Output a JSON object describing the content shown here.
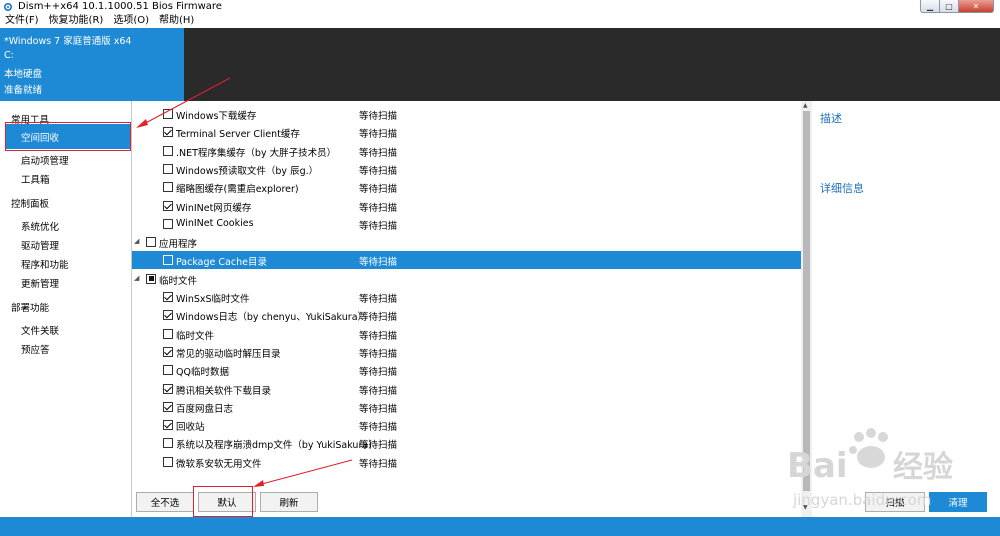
{
  "window": {
    "title": "Dism++x64 10.1.1000.51 Bios Firmware",
    "min_glyph": "▁",
    "max_glyph": "□",
    "close_glyph": "✕"
  },
  "menu": [
    {
      "label": "文件(F)"
    },
    {
      "label": "恢复功能(R)"
    },
    {
      "label": "选项(O)"
    },
    {
      "label": "帮助(H)"
    }
  ],
  "image_info": {
    "name": "*Windows 7 家庭普通版 x64",
    "drive": "C:",
    "disk": "本地硬盘",
    "status": "准备就绪"
  },
  "sidebar": {
    "groups": [
      {
        "label": "常用工具",
        "items": [
          {
            "label": "空间回收",
            "selected": true
          },
          {
            "label": "启动项管理"
          },
          {
            "label": "工具箱"
          }
        ]
      },
      {
        "label": "控制面板",
        "items": [
          {
            "label": "系统优化"
          },
          {
            "label": "驱动管理"
          },
          {
            "label": "程序和功能"
          },
          {
            "label": "更新管理"
          }
        ]
      },
      {
        "label": "部署功能",
        "items": [
          {
            "label": "文件关联"
          },
          {
            "label": "预应答"
          }
        ]
      }
    ]
  },
  "cleanup_list": [
    {
      "type": "item",
      "label": "Windows下载缓存",
      "state": "unchecked",
      "status": "等待扫描"
    },
    {
      "type": "item",
      "label": "Terminal Server Client缓存",
      "state": "checked",
      "status": "等待扫描"
    },
    {
      "type": "item",
      "label": ".NET程序集缓存（by 大胖子技术员）",
      "state": "unchecked",
      "status": "等待扫描"
    },
    {
      "type": "item",
      "label": "Windows预读取文件（by 辰g.）",
      "state": "unchecked",
      "status": "等待扫描"
    },
    {
      "type": "item",
      "label": "缩略图缓存(需重启explorer)",
      "state": "unchecked",
      "status": "等待扫描"
    },
    {
      "type": "item",
      "label": "WinINet网页缓存",
      "state": "checked",
      "status": "等待扫描"
    },
    {
      "type": "item",
      "label": "WinINet Cookies",
      "state": "unchecked",
      "status": "等待扫描"
    },
    {
      "type": "group",
      "label": "应用程序",
      "state": "unchecked"
    },
    {
      "type": "item",
      "label": "Package Cache目录",
      "state": "unchecked",
      "status": "等待扫描",
      "selected": true
    },
    {
      "type": "group",
      "label": "临时文件",
      "state": "partial"
    },
    {
      "type": "item",
      "label": "WinSxS临时文件",
      "state": "checked",
      "status": "等待扫描"
    },
    {
      "type": "item",
      "label": "Windows日志（by chenyu、YukiSakura）",
      "state": "checked",
      "status": "等待扫描"
    },
    {
      "type": "item",
      "label": "临时文件",
      "state": "unchecked",
      "status": "等待扫描"
    },
    {
      "type": "item",
      "label": "常见的驱动临时解压目录",
      "state": "checked",
      "status": "等待扫描"
    },
    {
      "type": "item",
      "label": "QQ临时数据",
      "state": "unchecked",
      "status": "等待扫描"
    },
    {
      "type": "item",
      "label": "腾讯相关软件下载目录",
      "state": "checked",
      "status": "等待扫描"
    },
    {
      "type": "item",
      "label": "百度网盘日志",
      "state": "checked",
      "status": "等待扫描"
    },
    {
      "type": "item",
      "label": "回收站",
      "state": "checked",
      "status": "等待扫描"
    },
    {
      "type": "item",
      "label": "系统以及程序崩溃dmp文件（by YukiSakura）",
      "state": "unchecked",
      "status": "等待扫描"
    },
    {
      "type": "item",
      "label": "微软系安软无用文件",
      "state": "unchecked",
      "status": "等待扫描"
    }
  ],
  "right_panel": {
    "description_title": "描述",
    "details_title": "详细信息"
  },
  "buttons": {
    "select_none": "全不选",
    "default": "默认",
    "refresh": "刷新",
    "scan": "扫描",
    "clean": "清理"
  },
  "watermark": {
    "brand_left": "Bai",
    "brand_right": "经验",
    "url": "jingyan.baidu.com"
  },
  "colors": {
    "accent": "#1e8ad6",
    "annotation": "#e0202a"
  }
}
